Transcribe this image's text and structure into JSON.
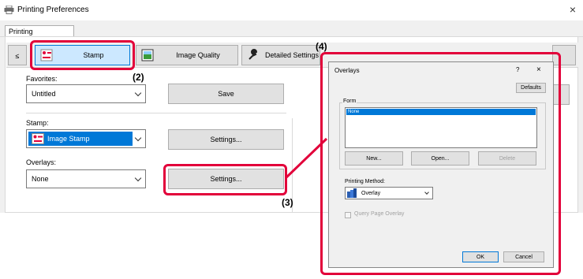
{
  "window": {
    "title": "Printing Preferences",
    "close": "×"
  },
  "tab": {
    "label": "Printing Preferences"
  },
  "toolbar": {
    "scroll_left": "≤",
    "items": [
      {
        "label": "Stamp",
        "icon": "stamp-icon"
      },
      {
        "label": "Image Quality",
        "icon": "image-quality-icon"
      },
      {
        "label": "Detailed Settings",
        "icon": "wrench-icon"
      }
    ]
  },
  "favorites": {
    "label": "Favorites:",
    "value": "Untitled",
    "save": "Save"
  },
  "stamp": {
    "label": "Stamp:",
    "value": "Image Stamp",
    "settings": "Settings..."
  },
  "overlays": {
    "label": "Overlays:",
    "value": "None",
    "settings": "Settings..."
  },
  "callouts": {
    "c2": "(2)",
    "c3": "(3)",
    "c4": "(4)"
  },
  "dialog": {
    "title": "Overlays",
    "help": "?",
    "close": "×",
    "defaults": "Defaults",
    "form_label": "Form",
    "form_items": [
      "None"
    ],
    "new": "New...",
    "open": "Open...",
    "delete": "Delete",
    "printing_method_label": "Printing Method:",
    "printing_method_value": "Overlay",
    "query_label": "Query Page Overlay",
    "ok": "OK",
    "cancel": "Cancel"
  },
  "colors": {
    "accent": "#0078d7",
    "highlight": "#e2003a",
    "panel": "#f0f0f0"
  }
}
